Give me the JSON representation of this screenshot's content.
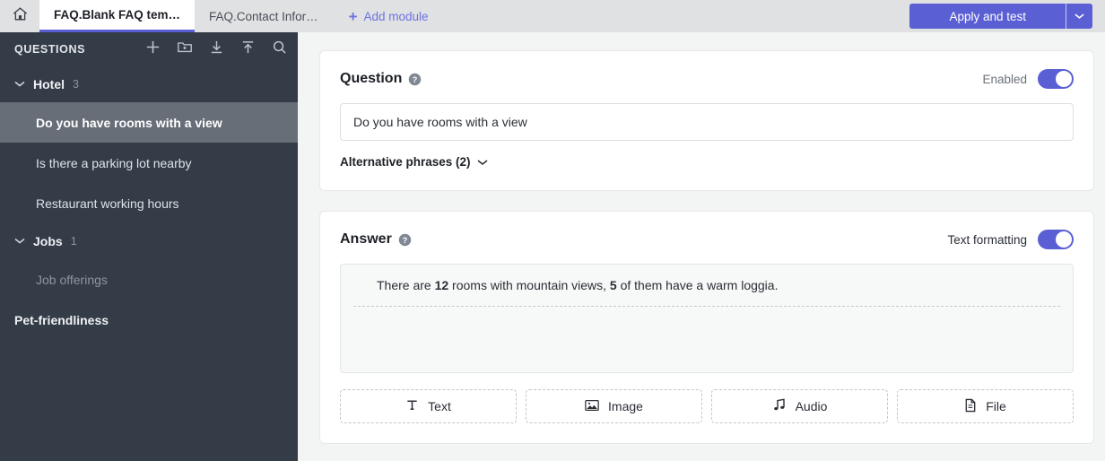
{
  "topbar": {
    "home_icon": "home-icon",
    "tabs": [
      {
        "label": "FAQ.Blank FAQ tem…",
        "active": true
      },
      {
        "label": "FAQ.Contact Infor…",
        "active": false
      }
    ],
    "add_module_label": "Add module",
    "add_module_icon": "plus-icon",
    "apply_label": "Apply and test",
    "apply_caret_icon": "chevron-down-icon",
    "accent_color": "#5b5fd4"
  },
  "sidebar": {
    "title": "QUESTIONS",
    "bg_color": "#343c48",
    "selected_bg_color": "#676e77",
    "tools": [
      {
        "name": "add-icon"
      },
      {
        "name": "new-folder-icon"
      },
      {
        "name": "download-icon"
      },
      {
        "name": "upload-icon"
      },
      {
        "name": "search-icon"
      }
    ],
    "groups": [
      {
        "name": "Hotel",
        "count": "3",
        "items": [
          {
            "label": "Do you have rooms with a view",
            "selected": true
          },
          {
            "label": "Is there a parking lot nearby",
            "selected": false
          },
          {
            "label": "Restaurant working hours",
            "selected": false
          }
        ]
      },
      {
        "name": "Jobs",
        "count": "1",
        "items": [
          {
            "label": "Job offerings",
            "selected": false,
            "muted": true
          }
        ]
      }
    ],
    "standalone": {
      "label": "Pet-friendliness"
    }
  },
  "question_card": {
    "title": "Question",
    "help_icon": "help-circle-icon",
    "toggle_label": "Enabled",
    "toggle_on": true,
    "value": "Do you have rooms with a view",
    "placeholder": "Do you have rooms with a view",
    "alternative_phrases_label": "Alternative phrases (2)",
    "alternative_phrases_icon": "chevron-down-icon"
  },
  "answer_card": {
    "title": "Answer",
    "help_icon": "help-circle-icon",
    "toggle_label": "Text formatting",
    "toggle_on": true,
    "text_parts": {
      "p1": "There are ",
      "b1": "12",
      "p2": " rooms with mountain views, ",
      "b2": "5",
      "p3": " of them have a warm loggia."
    },
    "attachments": [
      {
        "label": "Text",
        "icon": "text-icon"
      },
      {
        "label": "Image",
        "icon": "image-icon"
      },
      {
        "label": "Audio",
        "icon": "audio-icon"
      },
      {
        "label": "File",
        "icon": "file-icon"
      }
    ]
  }
}
